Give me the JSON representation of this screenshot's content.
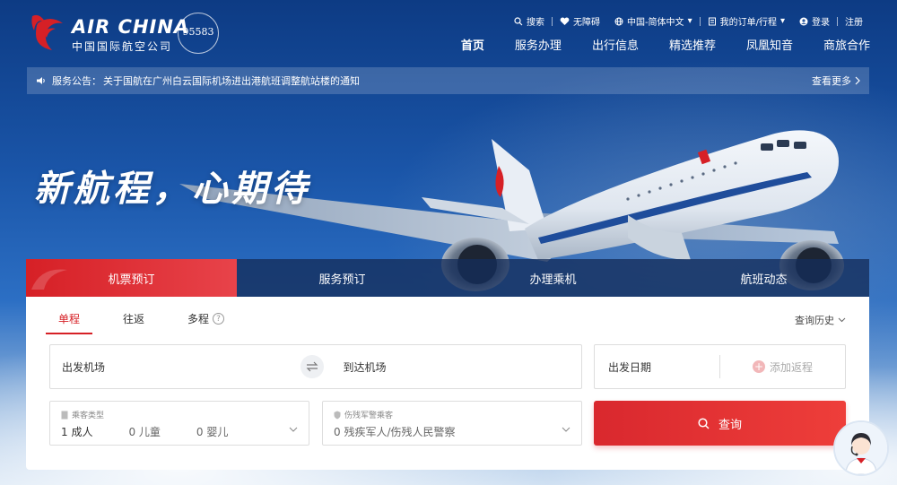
{
  "brand": {
    "name_en": "AIR CHINA",
    "name_cn": "中国国际航空公司",
    "hotline": "95583"
  },
  "utility": {
    "search": "搜索",
    "accessibility": "无障碍",
    "language": "中国-简体中文",
    "orders": "我的订单/行程",
    "login": "登录",
    "register": "注册"
  },
  "nav": {
    "items": [
      {
        "label": "首页",
        "active": true
      },
      {
        "label": "服务办理"
      },
      {
        "label": "出行信息"
      },
      {
        "label": "精选推荐"
      },
      {
        "label": "凤凰知音"
      },
      {
        "label": "商旅合作"
      }
    ]
  },
  "notice": {
    "label": "服务公告：",
    "text": "关于国航在广州白云国际机场进出港航班调整航站楼的通知",
    "more": "查看更多"
  },
  "hero": {
    "slogan": "新航程，心期待"
  },
  "booking": {
    "tabs": [
      "机票预订",
      "服务预订",
      "办理乘机",
      "航班动态"
    ],
    "trip_types": [
      "单程",
      "往返",
      "多程"
    ],
    "history": "查询历史",
    "from_placeholder": "出发机场",
    "to_placeholder": "到达机场",
    "depart_date": "出发日期",
    "add_return": "添加返程",
    "pax_label": "乘客类型",
    "pax_adult": "1 成人",
    "pax_child": "0 儿童",
    "pax_infant": "0 婴儿",
    "mil_label": "伤残军警乘客",
    "mil_value": "0 残疾军人/伤残人民警察",
    "search": "查询"
  },
  "colors": {
    "brand_red": "#d62026",
    "tab_dark": "#142d5a"
  }
}
